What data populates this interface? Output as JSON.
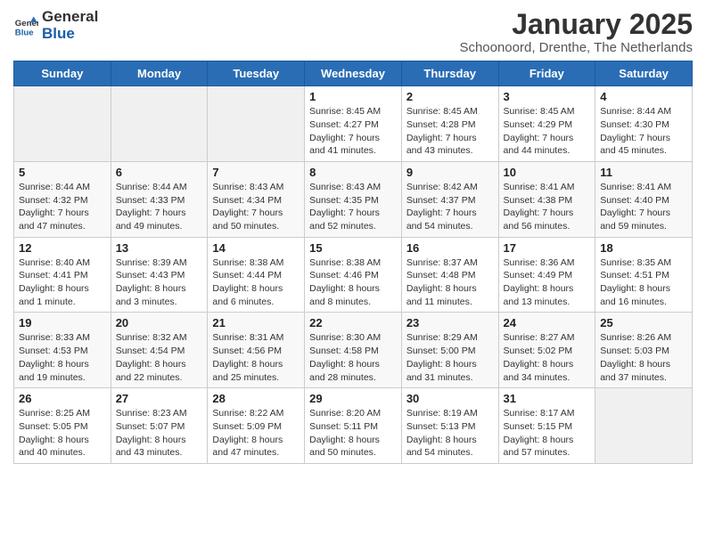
{
  "header": {
    "logo_general": "General",
    "logo_blue": "Blue",
    "title": "January 2025",
    "subtitle": "Schoonoord, Drenthe, The Netherlands"
  },
  "days_of_week": [
    "Sunday",
    "Monday",
    "Tuesday",
    "Wednesday",
    "Thursday",
    "Friday",
    "Saturday"
  ],
  "weeks": [
    {
      "days": [
        {
          "num": "",
          "detail": ""
        },
        {
          "num": "",
          "detail": ""
        },
        {
          "num": "",
          "detail": ""
        },
        {
          "num": "1",
          "detail": "Sunrise: 8:45 AM\nSunset: 4:27 PM\nDaylight: 7 hours\nand 41 minutes."
        },
        {
          "num": "2",
          "detail": "Sunrise: 8:45 AM\nSunset: 4:28 PM\nDaylight: 7 hours\nand 43 minutes."
        },
        {
          "num": "3",
          "detail": "Sunrise: 8:45 AM\nSunset: 4:29 PM\nDaylight: 7 hours\nand 44 minutes."
        },
        {
          "num": "4",
          "detail": "Sunrise: 8:44 AM\nSunset: 4:30 PM\nDaylight: 7 hours\nand 45 minutes."
        }
      ]
    },
    {
      "days": [
        {
          "num": "5",
          "detail": "Sunrise: 8:44 AM\nSunset: 4:32 PM\nDaylight: 7 hours\nand 47 minutes."
        },
        {
          "num": "6",
          "detail": "Sunrise: 8:44 AM\nSunset: 4:33 PM\nDaylight: 7 hours\nand 49 minutes."
        },
        {
          "num": "7",
          "detail": "Sunrise: 8:43 AM\nSunset: 4:34 PM\nDaylight: 7 hours\nand 50 minutes."
        },
        {
          "num": "8",
          "detail": "Sunrise: 8:43 AM\nSunset: 4:35 PM\nDaylight: 7 hours\nand 52 minutes."
        },
        {
          "num": "9",
          "detail": "Sunrise: 8:42 AM\nSunset: 4:37 PM\nDaylight: 7 hours\nand 54 minutes."
        },
        {
          "num": "10",
          "detail": "Sunrise: 8:41 AM\nSunset: 4:38 PM\nDaylight: 7 hours\nand 56 minutes."
        },
        {
          "num": "11",
          "detail": "Sunrise: 8:41 AM\nSunset: 4:40 PM\nDaylight: 7 hours\nand 59 minutes."
        }
      ]
    },
    {
      "days": [
        {
          "num": "12",
          "detail": "Sunrise: 8:40 AM\nSunset: 4:41 PM\nDaylight: 8 hours\nand 1 minute."
        },
        {
          "num": "13",
          "detail": "Sunrise: 8:39 AM\nSunset: 4:43 PM\nDaylight: 8 hours\nand 3 minutes."
        },
        {
          "num": "14",
          "detail": "Sunrise: 8:38 AM\nSunset: 4:44 PM\nDaylight: 8 hours\nand 6 minutes."
        },
        {
          "num": "15",
          "detail": "Sunrise: 8:38 AM\nSunset: 4:46 PM\nDaylight: 8 hours\nand 8 minutes."
        },
        {
          "num": "16",
          "detail": "Sunrise: 8:37 AM\nSunset: 4:48 PM\nDaylight: 8 hours\nand 11 minutes."
        },
        {
          "num": "17",
          "detail": "Sunrise: 8:36 AM\nSunset: 4:49 PM\nDaylight: 8 hours\nand 13 minutes."
        },
        {
          "num": "18",
          "detail": "Sunrise: 8:35 AM\nSunset: 4:51 PM\nDaylight: 8 hours\nand 16 minutes."
        }
      ]
    },
    {
      "days": [
        {
          "num": "19",
          "detail": "Sunrise: 8:33 AM\nSunset: 4:53 PM\nDaylight: 8 hours\nand 19 minutes."
        },
        {
          "num": "20",
          "detail": "Sunrise: 8:32 AM\nSunset: 4:54 PM\nDaylight: 8 hours\nand 22 minutes."
        },
        {
          "num": "21",
          "detail": "Sunrise: 8:31 AM\nSunset: 4:56 PM\nDaylight: 8 hours\nand 25 minutes."
        },
        {
          "num": "22",
          "detail": "Sunrise: 8:30 AM\nSunset: 4:58 PM\nDaylight: 8 hours\nand 28 minutes."
        },
        {
          "num": "23",
          "detail": "Sunrise: 8:29 AM\nSunset: 5:00 PM\nDaylight: 8 hours\nand 31 minutes."
        },
        {
          "num": "24",
          "detail": "Sunrise: 8:27 AM\nSunset: 5:02 PM\nDaylight: 8 hours\nand 34 minutes."
        },
        {
          "num": "25",
          "detail": "Sunrise: 8:26 AM\nSunset: 5:03 PM\nDaylight: 8 hours\nand 37 minutes."
        }
      ]
    },
    {
      "days": [
        {
          "num": "26",
          "detail": "Sunrise: 8:25 AM\nSunset: 5:05 PM\nDaylight: 8 hours\nand 40 minutes."
        },
        {
          "num": "27",
          "detail": "Sunrise: 8:23 AM\nSunset: 5:07 PM\nDaylight: 8 hours\nand 43 minutes."
        },
        {
          "num": "28",
          "detail": "Sunrise: 8:22 AM\nSunset: 5:09 PM\nDaylight: 8 hours\nand 47 minutes."
        },
        {
          "num": "29",
          "detail": "Sunrise: 8:20 AM\nSunset: 5:11 PM\nDaylight: 8 hours\nand 50 minutes."
        },
        {
          "num": "30",
          "detail": "Sunrise: 8:19 AM\nSunset: 5:13 PM\nDaylight: 8 hours\nand 54 minutes."
        },
        {
          "num": "31",
          "detail": "Sunrise: 8:17 AM\nSunset: 5:15 PM\nDaylight: 8 hours\nand 57 minutes."
        },
        {
          "num": "",
          "detail": ""
        }
      ]
    }
  ]
}
